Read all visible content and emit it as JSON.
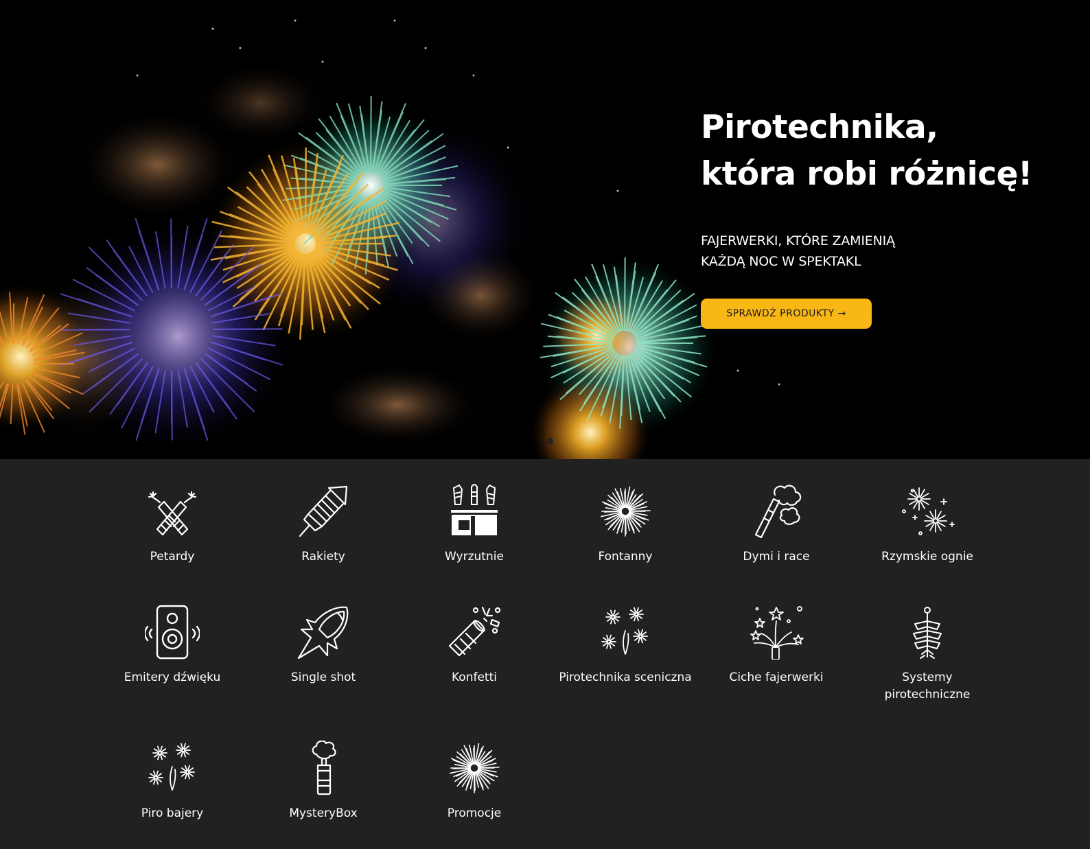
{
  "hero": {
    "title_line1": "Pirotechnika,",
    "title_line2": "która robi różnicę!",
    "subtitle_line1": "FAJERWERKI, KTÓRE ZAMIENIĄ",
    "subtitle_line2": "KAŻDĄ NOC W SPEKTAKL",
    "cta_label": "SPRAWDŹ PRODUKTY →",
    "colors": {
      "background": "#000000",
      "cta": "#f9b716"
    }
  },
  "categories_section": {
    "background": "#212121",
    "items": [
      {
        "label": "Petardy",
        "icon": "firecrackers-icon"
      },
      {
        "label": "Rakiety",
        "icon": "rocket-icon"
      },
      {
        "label": "Wyrzutnie",
        "icon": "launcher-box-icon"
      },
      {
        "label": "Fontanny",
        "icon": "fountain-burst-icon"
      },
      {
        "label": "Dymi i race",
        "icon": "smoke-flare-icon"
      },
      {
        "label": "Rzymskie ognie",
        "icon": "roman-candle-sparkles-icon"
      },
      {
        "label": "Emitery dźwięku",
        "icon": "speaker-icon"
      },
      {
        "label": "Single shot",
        "icon": "comet-shot-icon"
      },
      {
        "label": "Konfetti",
        "icon": "confetti-cannon-icon"
      },
      {
        "label": "Pirotechnika sceniczna",
        "icon": "stage-sparklers-icon"
      },
      {
        "label": "Ciche fajerwerki",
        "icon": "quiet-fireworks-icon"
      },
      {
        "label_line1": "Systemy",
        "label_line2": "pirotechniczne",
        "icon": "firing-system-icon"
      },
      {
        "label": "Piro bajery",
        "icon": "sparkles-icon"
      },
      {
        "label": "MysteryBox",
        "icon": "mystery-box-icon"
      },
      {
        "label": "Promocje",
        "icon": "burst-icon"
      }
    ]
  }
}
